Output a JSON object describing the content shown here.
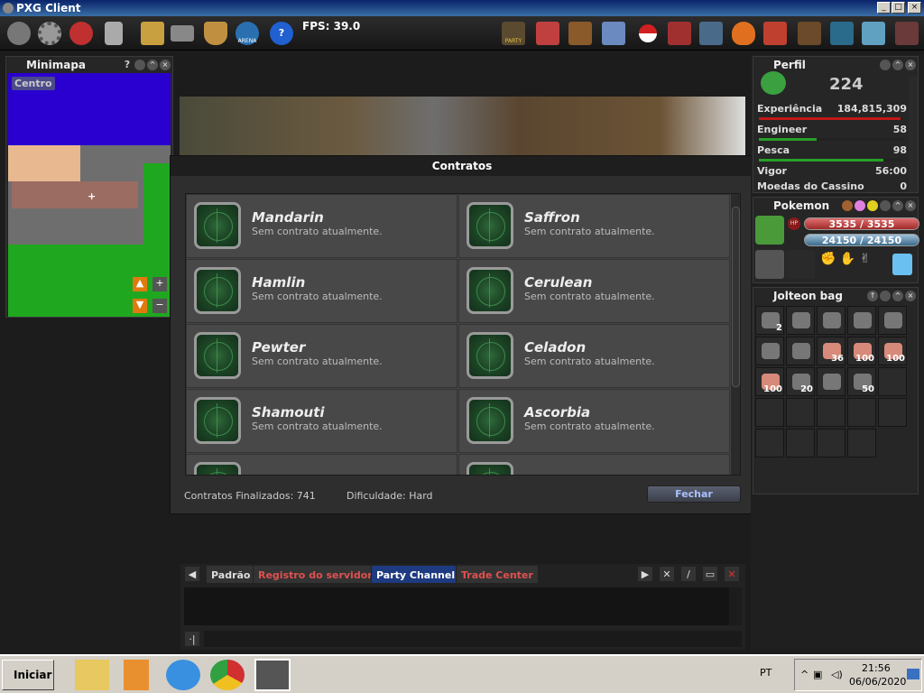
{
  "window": {
    "title": "PXG Client",
    "controls": [
      "_",
      "□",
      "×"
    ]
  },
  "toolbar": {
    "fps": "FPS: 39.0",
    "arena_label": "ARENA",
    "party_label": "PARTY",
    "left_icons": [
      "power-icon",
      "gear-icon",
      "mute-icon",
      "lock-icon",
      "quest-book-icon",
      "keyboard-icon",
      "guild-shield-icon",
      "arena-globe-icon",
      "help-icon"
    ],
    "right_icons": [
      "party-icon",
      "notes-icon",
      "chest-icon",
      "diamond-icon",
      "pokeball-icon",
      "bag-icon",
      "sword-icon",
      "fire-icon",
      "trainer-icon",
      "character-icon",
      "ghost-icon",
      "bird-icon",
      "calendar-icon"
    ]
  },
  "minimap": {
    "title": "Minimapa",
    "help": "?",
    "center_button": "Centro",
    "zoom_in": "+",
    "zoom_out": "−"
  },
  "dialog": {
    "title": "Contratos",
    "contracts": [
      {
        "city": "Mandarin",
        "status": "Sem contrato atualmente."
      },
      {
        "city": "Saffron",
        "status": "Sem contrato atualmente."
      },
      {
        "city": "Hamlin",
        "status": "Sem contrato atualmente."
      },
      {
        "city": "Cerulean",
        "status": "Sem contrato atualmente."
      },
      {
        "city": "Pewter",
        "status": "Sem contrato atualmente."
      },
      {
        "city": "Celadon",
        "status": "Sem contrato atualmente."
      },
      {
        "city": "Shamouti",
        "status": "Sem contrato atualmente."
      },
      {
        "city": "Ascorbia",
        "status": "Sem contrato atualmente."
      }
    ],
    "finished": "Contratos Finalizados: 741",
    "difficulty": "Dificuldade: Hard",
    "close_button": "Fechar"
  },
  "profile": {
    "title": "Perfil",
    "level": "224",
    "stats": [
      {
        "label": "Experiência",
        "value": "184,815,309",
        "progress": 0.98,
        "color": "#c01818"
      },
      {
        "label": "Engineer",
        "value": "58",
        "progress": 0.4,
        "color": "#28a028"
      },
      {
        "label": "Pesca",
        "value": "98",
        "progress": 0.86,
        "color": "#28a028"
      },
      {
        "label": "Vigor",
        "value": "56:00"
      },
      {
        "label": "Moedas do Cassino",
        "value": "0"
      }
    ]
  },
  "pokemon": {
    "title": "Pokemon",
    "hp": "3535 / 3535",
    "hp_progress": 1.0,
    "energy": "24150 / 24150",
    "energy_progress": 1.0,
    "hp_badge": "HP"
  },
  "bag": {
    "title": "Jolteon bag",
    "items": [
      {
        "icon": "yellow-device-icon",
        "count": "2"
      },
      {
        "icon": "goggles-icon",
        "count": ""
      },
      {
        "icon": "capsule-icon",
        "count": ""
      },
      {
        "icon": "pickaxe-icon",
        "count": ""
      },
      {
        "icon": "dark-device-icon",
        "count": ""
      },
      {
        "icon": "heart-flower-icon",
        "count": ""
      },
      {
        "icon": "blue-cloth-icon",
        "count": ""
      },
      {
        "icon": "meat-pile-icon",
        "count": "36"
      },
      {
        "icon": "meat-pile-icon",
        "count": "100"
      },
      {
        "icon": "meat-pile-icon",
        "count": "100"
      },
      {
        "icon": "meat-pile-icon",
        "count": "100"
      },
      {
        "icon": "green-device-icon",
        "count": "20"
      },
      {
        "icon": "toolbox-icon",
        "count": ""
      },
      {
        "icon": "bread-icon",
        "count": "50"
      },
      {
        "icon": "",
        "count": ""
      },
      {
        "icon": "",
        "count": ""
      },
      {
        "icon": "",
        "count": ""
      },
      {
        "icon": "",
        "count": ""
      },
      {
        "icon": "",
        "count": ""
      },
      {
        "icon": "",
        "count": ""
      },
      {
        "icon": "",
        "count": ""
      },
      {
        "icon": "",
        "count": ""
      },
      {
        "icon": "",
        "count": ""
      },
      {
        "icon": "",
        "count": ""
      }
    ]
  },
  "chat": {
    "tabs": [
      {
        "label": "Padrão",
        "color": "#aaaaaa"
      },
      {
        "label": "Registro do servidor",
        "color": "#e05050"
      },
      {
        "label": "Party Channel",
        "color": "#ffffff",
        "active": true
      },
      {
        "label": "Trade Center",
        "color": "#e05050"
      }
    ]
  },
  "taskbar": {
    "start": "Iniciar",
    "lang": "PT",
    "time": "21:56",
    "date": "06/06/2020"
  }
}
